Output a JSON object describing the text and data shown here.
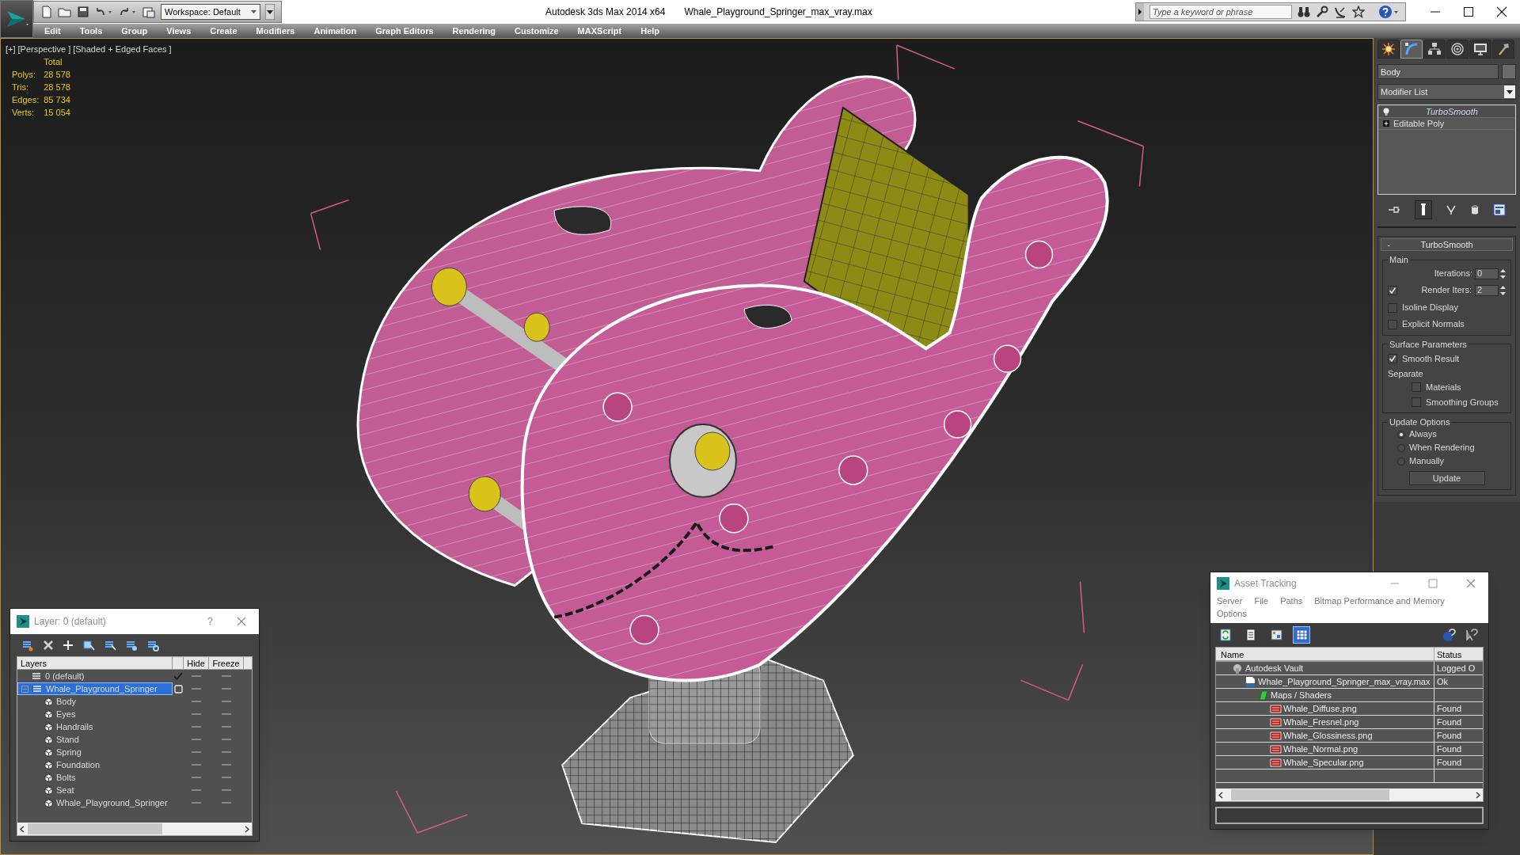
{
  "window": {
    "title": "Autodesk 3ds Max  2014 x64",
    "file": "Whale_Playground_Springer_max_vray.max"
  },
  "quick_access": {
    "workspace": "Workspace: Default"
  },
  "search": {
    "placeholder": "Type a keyword or phrase"
  },
  "menu": [
    "Edit",
    "Tools",
    "Group",
    "Views",
    "Create",
    "Modifiers",
    "Animation",
    "Graph Editors",
    "Rendering",
    "Customize",
    "MAXScript",
    "Help"
  ],
  "viewport": {
    "labels": [
      "[+]",
      "[Perspective ]",
      "[Shaded + Edged Faces ]"
    ],
    "stats": {
      "header": "Total",
      "rows": [
        {
          "label": "Polys:",
          "value": "28 578"
        },
        {
          "label": "Tris:",
          "value": "28 578"
        },
        {
          "label": "Edges:",
          "value": "85 734"
        },
        {
          "label": "Verts:",
          "value": "15 054"
        }
      ]
    }
  },
  "command_panel": {
    "tabs": [
      {
        "kind": "create",
        "selected": false
      },
      {
        "kind": "modify",
        "selected": true
      },
      {
        "kind": "hierarchy",
        "selected": false
      },
      {
        "kind": "motion",
        "selected": false
      },
      {
        "kind": "display",
        "selected": false
      },
      {
        "kind": "utilities",
        "selected": false
      }
    ],
    "object_name": "Body",
    "modifier_list": "Modifier List",
    "stack": [
      {
        "kind": "modifier",
        "label": "TurboSmooth",
        "selected": true
      },
      {
        "kind": "base_object",
        "label": "Editable Poly",
        "selected": false
      }
    ],
    "rollout": {
      "toggle": "-",
      "title": "TurboSmooth",
      "groups": [
        {
          "title": "Main",
          "controls": [
            {
              "kind": "spinner",
              "label": "Iterations:",
              "value": "0"
            },
            {
              "kind": "check_spinner",
              "label": "Render Iters:",
              "value": "2",
              "checked": true
            },
            {
              "kind": "checkbox",
              "label": "Isoline Display",
              "checked": false
            },
            {
              "kind": "checkbox",
              "label": "Explicit Normals",
              "checked": false
            }
          ]
        },
        {
          "title": "Surface Parameters",
          "controls": [
            {
              "kind": "checkbox",
              "label": "Smooth Result",
              "checked": true
            },
            {
              "kind": "text",
              "label": "Separate"
            },
            {
              "kind": "sub_checkbox",
              "label": "Materials",
              "checked": false
            },
            {
              "kind": "sub_checkbox",
              "label": "Smoothing Groups",
              "checked": false
            }
          ]
        },
        {
          "title": "Update Options",
          "controls": [
            {
              "kind": "radio",
              "label": "Always",
              "selected": true
            },
            {
              "kind": "radio",
              "label": "When Rendering",
              "selected": false
            },
            {
              "kind": "radio",
              "label": "Manually",
              "selected": false
            },
            {
              "kind": "button",
              "label": "Update"
            }
          ]
        }
      ]
    }
  },
  "layer_dialog": {
    "title": "Layer: 0 (default)",
    "help": "?",
    "columns": [
      "Layers",
      "Hide",
      "Freeze"
    ],
    "layers": [
      {
        "kind": "layer",
        "name": "0 (default)",
        "current": true,
        "selected": false,
        "hidden": false,
        "frozen": false
      },
      {
        "kind": "layer",
        "name": "Whale_Playground_Springer",
        "current": false,
        "selected": true,
        "expanded": true,
        "hidden": false,
        "frozen": false,
        "children": [
          {
            "kind": "object",
            "name": "Body",
            "hidden": false,
            "frozen": false
          },
          {
            "kind": "object",
            "name": "Eyes",
            "hidden": false,
            "frozen": false
          },
          {
            "kind": "object",
            "name": "Handrails",
            "hidden": false,
            "frozen": false
          },
          {
            "kind": "object",
            "name": "Stand",
            "hidden": false,
            "frozen": false
          },
          {
            "kind": "object",
            "name": "Spring",
            "hidden": false,
            "frozen": false
          },
          {
            "kind": "object",
            "name": "Foundation",
            "hidden": false,
            "frozen": false
          },
          {
            "kind": "object",
            "name": "Bolts",
            "hidden": false,
            "frozen": false
          },
          {
            "kind": "object",
            "name": "Seat",
            "hidden": false,
            "frozen": false
          },
          {
            "kind": "object",
            "name": "Whale_Playground_Springer",
            "hidden": false,
            "frozen": false
          }
        ]
      }
    ]
  },
  "asset_tracking": {
    "title": "Asset Tracking",
    "menu": [
      "Server",
      "File",
      "Paths",
      "Bitmap Performance and Memory",
      "Options"
    ],
    "toolbar": [
      {
        "kind": "refresh",
        "selected": false
      },
      {
        "kind": "list",
        "selected": false
      },
      {
        "kind": "thumbnails",
        "selected": false
      },
      {
        "kind": "table",
        "selected": true
      }
    ],
    "columns": [
      "Name",
      "Status"
    ],
    "tree": [
      {
        "kind": "vault",
        "name": "Autodesk Vault",
        "status": "Logged O",
        "children": [
          {
            "kind": "max",
            "name": "Whale_Playground_Springer_max_vray.max",
            "status": "Ok",
            "children": [
              {
                "kind": "folder",
                "name": "Maps / Shaders",
                "children": [
                  {
                    "kind": "png",
                    "name": "Whale_Diffuse.png",
                    "status": "Found"
                  },
                  {
                    "kind": "png",
                    "name": "Whale_Fresnel.png",
                    "status": "Found"
                  },
                  {
                    "kind": "png",
                    "name": "Whale_Glossiness.png",
                    "status": "Found"
                  },
                  {
                    "kind": "png",
                    "name": "Whale_Normal.png",
                    "status": "Found"
                  },
                  {
                    "kind": "png",
                    "name": "Whale_Specular.png",
                    "status": "Found"
                  }
                ]
              }
            ]
          }
        ]
      }
    ]
  }
}
